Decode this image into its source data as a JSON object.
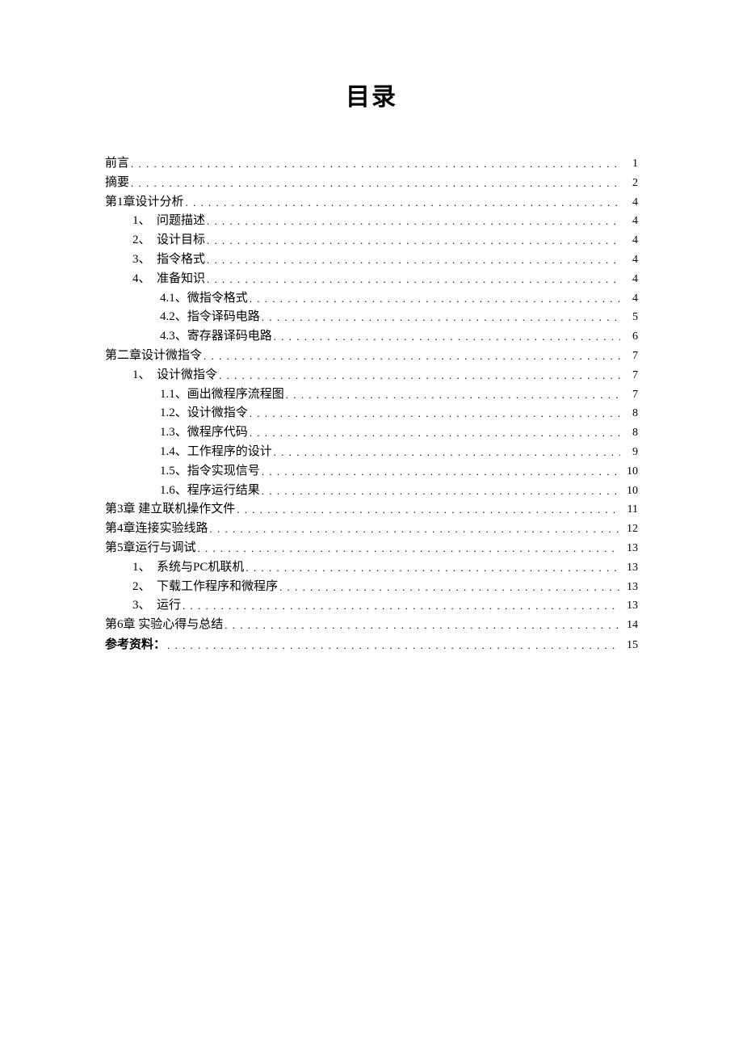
{
  "title": "目录",
  "entries": [
    {
      "level": 0,
      "num": "",
      "text": "前言",
      "page": "1",
      "bold": false
    },
    {
      "level": 0,
      "num": "",
      "text": "摘要",
      "page": "2",
      "bold": false
    },
    {
      "level": 0,
      "num": "",
      "text": "第1章设计分析",
      "page": "4",
      "bold": false
    },
    {
      "level": 1,
      "num": "1、",
      "text": "问题描述",
      "page": "4",
      "bold": false
    },
    {
      "level": 1,
      "num": "2、",
      "text": "设计目标",
      "page": "4",
      "bold": false
    },
    {
      "level": 1,
      "num": "3、",
      "text": "指令格式",
      "page": "4",
      "bold": false
    },
    {
      "level": 1,
      "num": "4、",
      "text": "准备知识",
      "page": "4",
      "bold": false
    },
    {
      "level": 2,
      "num": "4.1、",
      "text": "微指令格式",
      "page": "4",
      "bold": false
    },
    {
      "level": 2,
      "num": "4.2、",
      "text": " 指令译码电路",
      "page": "5",
      "bold": false
    },
    {
      "level": 2,
      "num": "4.3、",
      "text": "寄存器译码电路",
      "page": "6",
      "bold": false
    },
    {
      "level": 0,
      "num": "",
      "text": "第二章设计微指令",
      "page": "7",
      "bold": false
    },
    {
      "level": 1,
      "num": "1、",
      "text": "设计微指令 ",
      "page": "7",
      "bold": false
    },
    {
      "level": 2,
      "num": "1.1、",
      "text": "画出微程序流程图",
      "page": "7",
      "bold": false
    },
    {
      "level": 2,
      "num": "1.2、",
      "text": "设计微指令",
      "page": "8",
      "bold": false
    },
    {
      "level": 2,
      "num": "1.3、",
      "text": "微程序代码",
      "page": "8",
      "bold": false
    },
    {
      "level": 2,
      "num": "1.4、",
      "text": "工作程序的设计",
      "page": "9",
      "bold": false
    },
    {
      "level": 2,
      "num": "1.5、",
      "text": "指令实现信号",
      "page": "10",
      "bold": false
    },
    {
      "level": 2,
      "num": "1.6、",
      "text": "程序运行结果",
      "page": "10",
      "bold": false
    },
    {
      "level": 0,
      "num": "",
      "text": "第3章 建立联机操作文件",
      "page": "11",
      "bold": false
    },
    {
      "level": 0,
      "num": "",
      "text": "第4章连接实验线路",
      "page": "12",
      "bold": false
    },
    {
      "level": 0,
      "num": "",
      "text": "第5章运行与调试",
      "page": "13",
      "bold": false
    },
    {
      "level": 1,
      "num": "1、",
      "text": "系统与PC机联机 ",
      "page": "13",
      "bold": false
    },
    {
      "level": 1,
      "num": "2、",
      "text": "下载工作程序和微程序",
      "page": "13",
      "bold": false
    },
    {
      "level": 1,
      "num": "3、",
      "text": "运行 ",
      "page": "13",
      "bold": false
    },
    {
      "level": 0,
      "num": "",
      "text": "第6章 实验心得与总结",
      "page": "14",
      "bold": false
    },
    {
      "level": 0,
      "num": "",
      "text": "参考资料：",
      "page": "15",
      "bold": true
    }
  ]
}
